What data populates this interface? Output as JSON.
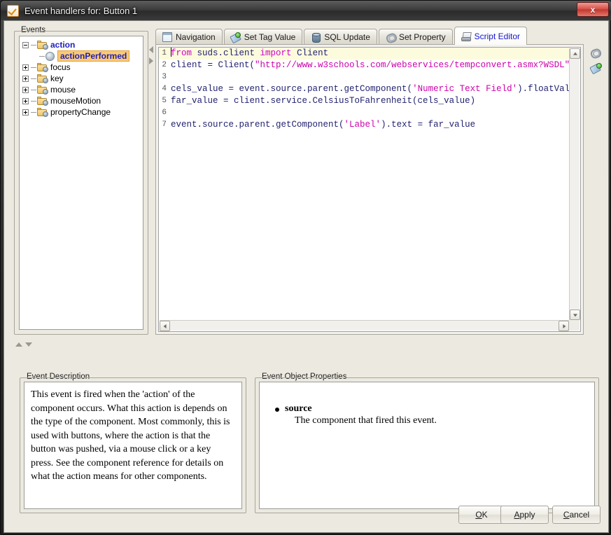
{
  "window": {
    "title": "Event handlers for: Button 1",
    "icon": "checkmark-icon",
    "close_label": "x"
  },
  "events_panel": {
    "group_title": "Events",
    "tree": [
      {
        "label": "action",
        "expander": "minus",
        "icon": "folder-gear-icon",
        "style": "bold-blue",
        "indent": 0
      },
      {
        "label": "actionPerformed",
        "expander": "none",
        "icon": "gear-icon",
        "style": "selected",
        "indent": 1
      },
      {
        "label": "focus",
        "expander": "plus",
        "icon": "folder-gear-icon",
        "style": "normal",
        "indent": 0
      },
      {
        "label": "key",
        "expander": "plus",
        "icon": "folder-gear-icon",
        "style": "normal",
        "indent": 0
      },
      {
        "label": "mouse",
        "expander": "plus",
        "icon": "folder-gear-icon",
        "style": "normal",
        "indent": 0
      },
      {
        "label": "mouseMotion",
        "expander": "plus",
        "icon": "folder-gear-icon",
        "style": "normal",
        "indent": 0
      },
      {
        "label": "propertyChange",
        "expander": "plus",
        "icon": "folder-gear-icon",
        "style": "normal",
        "indent": 0
      }
    ]
  },
  "splitters": {
    "vertical_left_arrow": "collapse-left-arrow",
    "vertical_right_arrow": "collapse-right-arrow",
    "horizontal_up_arrow": "collapse-up-arrow",
    "horizontal_down_arrow": "collapse-down-arrow"
  },
  "tabs": [
    {
      "label": "Navigation",
      "icon": "window-icon",
      "active": false
    },
    {
      "label": "Set Tag Value",
      "icon": "tag-icon",
      "active": false
    },
    {
      "label": "SQL Update",
      "icon": "database-icon",
      "active": false
    },
    {
      "label": "Set Property",
      "icon": "paperclip-icon",
      "active": false
    },
    {
      "label": "Script Editor",
      "icon": "scroll-icon",
      "active": true
    }
  ],
  "editor": {
    "active_line": 1,
    "lines": [
      {
        "n": "1",
        "segments": [
          {
            "t": "from",
            "c": "kw"
          },
          {
            "t": " suds.client ",
            "c": ""
          },
          {
            "t": "import",
            "c": "kw"
          },
          {
            "t": " Client",
            "c": ""
          }
        ]
      },
      {
        "n": "2",
        "segments": [
          {
            "t": "client = Client(",
            "c": ""
          },
          {
            "t": "\"http://www.w3schools.com/webservices/tempconvert.asmx?WSDL\"",
            "c": "str"
          },
          {
            "t": ")",
            "c": ""
          }
        ]
      },
      {
        "n": "3",
        "segments": [
          {
            "t": "",
            "c": ""
          }
        ]
      },
      {
        "n": "4",
        "segments": [
          {
            "t": "cels_value = event.source.parent.getComponent(",
            "c": ""
          },
          {
            "t": "'Numeric Text Field'",
            "c": "str"
          },
          {
            "t": ").floatValue",
            "c": ""
          }
        ]
      },
      {
        "n": "5",
        "segments": [
          {
            "t": "far_value = client.service.CelsiusToFahrenheit(cels_value)",
            "c": ""
          }
        ]
      },
      {
        "n": "6",
        "segments": [
          {
            "t": "",
            "c": ""
          }
        ]
      },
      {
        "n": "7",
        "segments": [
          {
            "t": "event.source.parent.getComponent(",
            "c": ""
          },
          {
            "t": "'Label'",
            "c": "str"
          },
          {
            "t": ").text = far_value",
            "c": ""
          }
        ]
      }
    ]
  },
  "rail_icons": [
    {
      "name": "paperclip-icon"
    },
    {
      "name": "tag-icon"
    }
  ],
  "description_panel": {
    "group_title": "Event Description",
    "text": "This event is fired when the 'action' of the component occurs. What this action is depends on the type of the component. Most commonly, this is used with buttons, where the action is that the button was pushed, via a mouse click or a key press. See the component reference for details on what the action means for other components."
  },
  "properties_panel": {
    "group_title": "Event Object Properties",
    "items": [
      {
        "name": "source",
        "description": "The component that fired this event."
      }
    ]
  },
  "buttons": {
    "ok": {
      "pre": "",
      "mnemonic": "O",
      "post": "K"
    },
    "apply": {
      "pre": "",
      "mnemonic": "A",
      "post": "pply"
    },
    "cancel": {
      "pre": "",
      "mnemonic": "C",
      "post": "ancel"
    }
  },
  "colors": {
    "keyword": "#cc00cc",
    "string": "#cc00aa",
    "code_text": "#201f6e",
    "active_tab_text": "#1414cf",
    "selection_bg": "#fbca72",
    "tree_bold": "#1d1dbf",
    "window_bg": "#ece9e0",
    "current_line": "#fcfbdd"
  }
}
